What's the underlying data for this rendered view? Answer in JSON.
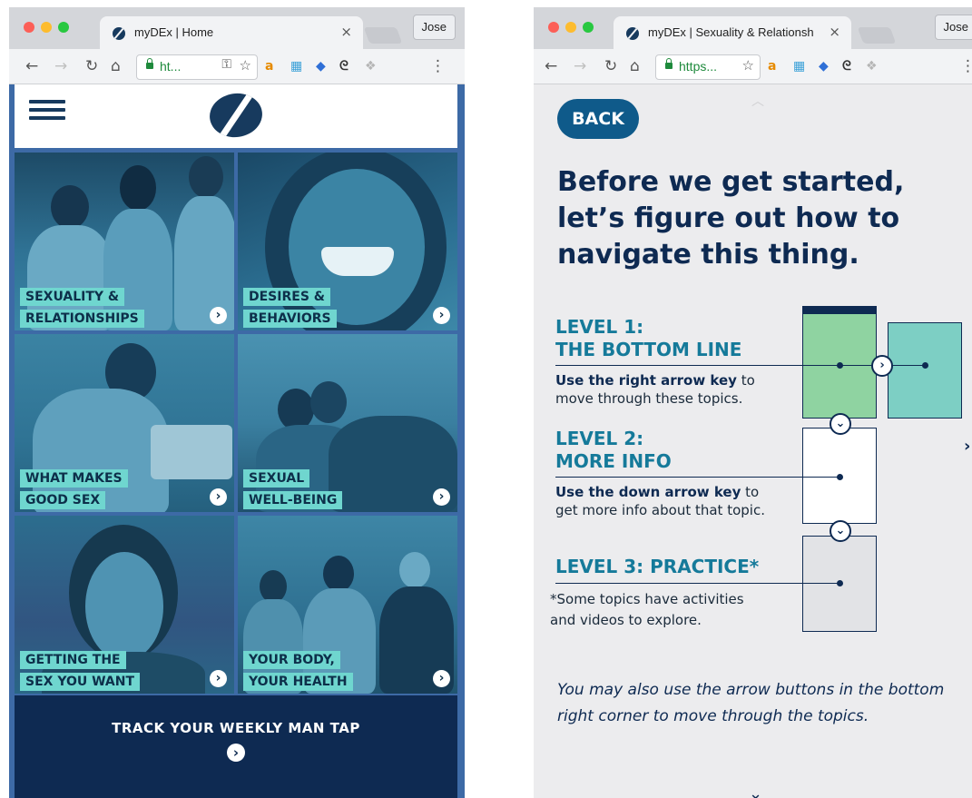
{
  "left_window": {
    "tab_title": "myDEx | Home",
    "tab_close": "×",
    "profile": "Jose",
    "url": "ht...",
    "header": {
      "logo": "myDEx logo"
    },
    "tiles": [
      {
        "lines": [
          "SEXUALITY &",
          "RELATIONSHIPS"
        ]
      },
      {
        "lines": [
          "DESIRES &",
          "BEHAVIORS"
        ]
      },
      {
        "lines": [
          "WHAT MAKES",
          "GOOD SEX"
        ]
      },
      {
        "lines": [
          "SEXUAL",
          "WELL-BEING"
        ]
      },
      {
        "lines": [
          "GETTING THE",
          "SEX YOU WANT"
        ]
      },
      {
        "lines": [
          "YOUR BODY,",
          "YOUR HEALTH"
        ]
      }
    ],
    "footer": {
      "cta": "TRACK YOUR WEEKLY MAN TAP"
    }
  },
  "right_window": {
    "tab_title": "myDEx | Sexuality & Relationsh",
    "tab_close": "×",
    "profile": "Jose",
    "url": "https...",
    "back": "BACK",
    "headline": "Before we get started, let’s figure out how to navigate this thing.",
    "levels": [
      {
        "title_1": "LEVEL 1:",
        "title_2": "THE BOTTOM LINE",
        "bold": "Use the right arrow key",
        "rest_1": " to",
        "rest_2": "move through these topics."
      },
      {
        "title_1": "LEVEL 2:",
        "title_2": "MORE INFO",
        "bold": "Use the down arrow key",
        "rest_1": " to",
        "rest_2": "get more info about that topic."
      },
      {
        "title_1": "LEVEL 3: PRACTICE*"
      }
    ],
    "note_1": "*Some topics have activities",
    "note_2": "and videos to explore.",
    "tip": "You may also use the arrow buttons in the bottom right corner to move through the topics."
  },
  "colors": {
    "navy": "#0e2a52",
    "teal_caption": "#6fd6cf",
    "level_title": "#157a9a",
    "card_green": "#8fd3a1",
    "card_teal": "#7dcfc4"
  }
}
